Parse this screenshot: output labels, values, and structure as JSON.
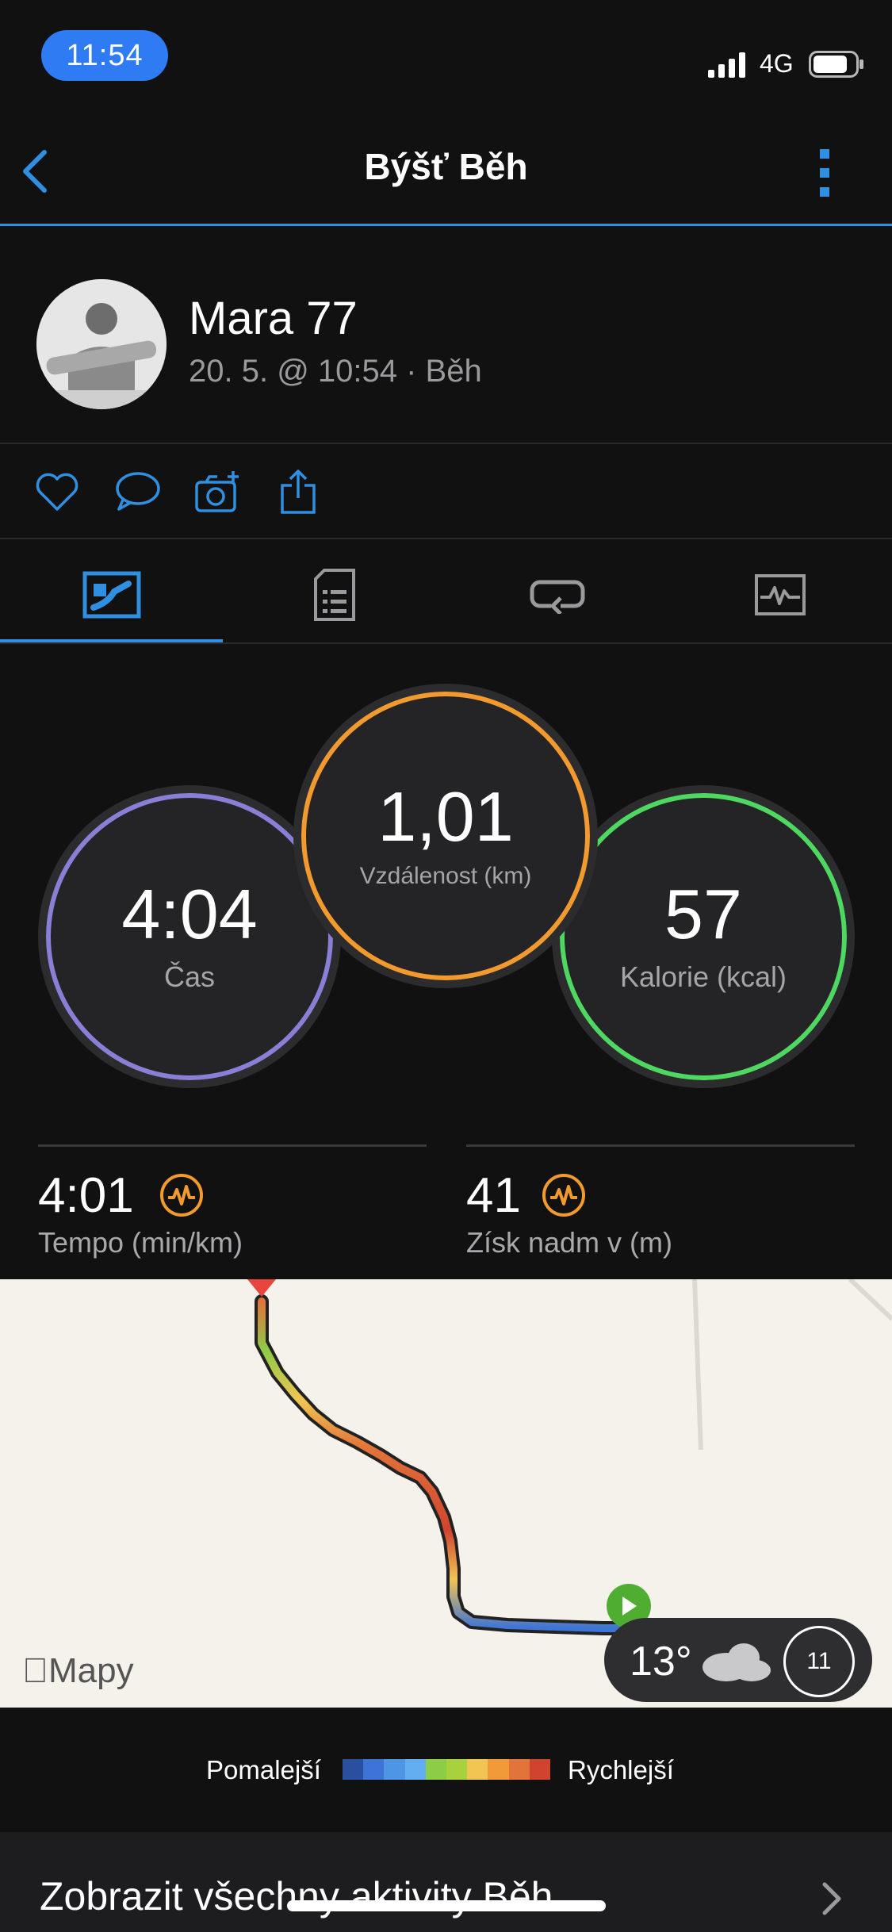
{
  "status": {
    "time": "11:54",
    "network": "4G"
  },
  "header": {
    "title": "Býšť Běh"
  },
  "profile": {
    "name": "Mara 77",
    "meta": "20. 5. @ 10:54 · Běh"
  },
  "rings": [
    {
      "value": "4:04",
      "label": "Čas",
      "color": "#5b8fd8"
    },
    {
      "value": "1,01",
      "label": "Vzdálenost (km)",
      "color": "#f39a2e"
    },
    {
      "value": "57",
      "label": "Kalorie (kcal)",
      "color": "#4fd861"
    }
  ],
  "stats": [
    {
      "value": "4:01",
      "label": "Tempo (min/km)"
    },
    {
      "value": "41",
      "label": "Získ nadm v (m)"
    }
  ],
  "map": {
    "provider": "Mapy",
    "temperature": "13°",
    "wind": "11"
  },
  "legend": {
    "slower": "Pomalejší",
    "faster": "Rychlejší",
    "colors": [
      "#2a4f9e",
      "#3d74d6",
      "#4f95e6",
      "#62aef0",
      "#8ccc46",
      "#a7d23e",
      "#f0c552",
      "#f09a3a",
      "#e2733a",
      "#d0442f"
    ]
  },
  "footer": {
    "text": "Zobrazit všechny aktivity Běh"
  },
  "accent": "#2f8fe0"
}
